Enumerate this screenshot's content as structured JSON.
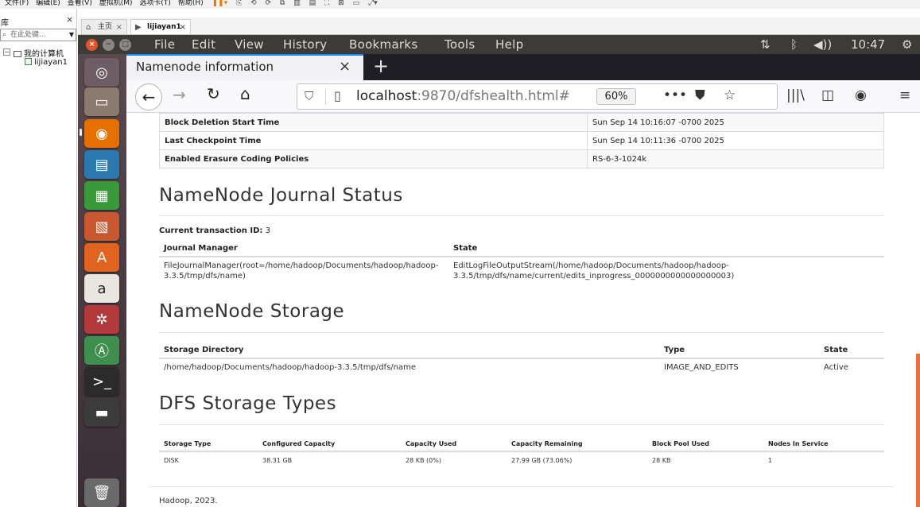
{
  "host": {
    "menubar": [
      "文件(F)",
      "编辑(E)",
      "查看(V)",
      "虚拟机(M)",
      "选项卡(T)",
      "帮助(H)"
    ],
    "library": {
      "title": "库",
      "close": "×",
      "search_placeholder": "在此处键...",
      "tree_root": "我的计算机",
      "tree_vm": "lijiayan1"
    },
    "tabs": [
      {
        "label": "主页",
        "close": "×"
      },
      {
        "label": "lijiayan1",
        "close": "×"
      }
    ]
  },
  "ubuntu": {
    "menus": [
      "File",
      "Edit",
      "View",
      "History",
      "Bookmarks",
      "Tools",
      "Help"
    ],
    "clock": "10:47",
    "colors": {
      "panel": "#3c3b37",
      "close": "#e0562a"
    }
  },
  "firefox": {
    "tab_title": "Namenode information",
    "new_tab": "+",
    "url_host": "localhost",
    "url_rest": ":9870/dfshealth.html#",
    "zoom": "60%",
    "accent": "#0a84ff"
  },
  "page": {
    "summary_rows": [
      {
        "key": "Block Deletion Start Time",
        "value": "Sun Sep 14 10:16:07 -0700 2025"
      },
      {
        "key": "Last Checkpoint Time",
        "value": "Sun Sep 14 10:11:36 -0700 2025"
      },
      {
        "key": "Enabled Erasure Coding Policies",
        "value": "RS-6-3-1024k"
      }
    ],
    "journal": {
      "heading": "NameNode Journal Status",
      "txid_label": "Current transaction ID:",
      "txid_value": "3",
      "headers": [
        "Journal Manager",
        "State"
      ],
      "rows": [
        [
          "FileJournalManager(root=/home/hadoop/Documents/hadoop/hadoop-3.3.5/tmp/dfs/name)",
          "EditLogFileOutputStream(/home/hadoop/Documents/hadoop/hadoop-3.3.5/tmp/dfs/name/current/edits_inprogress_0000000000000000003)"
        ]
      ]
    },
    "storage": {
      "heading": "NameNode Storage",
      "headers": [
        "Storage Directory",
        "Type",
        "State"
      ],
      "rows": [
        [
          "/home/hadoop/Documents/hadoop/hadoop-3.3.5/tmp/dfs/name",
          "IMAGE_AND_EDITS",
          "Active"
        ]
      ]
    },
    "dfs_types": {
      "heading": "DFS Storage Types",
      "headers": [
        "Storage Type",
        "Configured Capacity",
        "Capacity Used",
        "Capacity Remaining",
        "Block Pool Used",
        "Nodes In Service"
      ],
      "rows": [
        [
          "DISK",
          "38.31 GB",
          "28 KB (0%)",
          "27.99 GB (73.06%)",
          "28 KB",
          "1"
        ]
      ]
    },
    "footer": "Hadoop, 2023."
  }
}
